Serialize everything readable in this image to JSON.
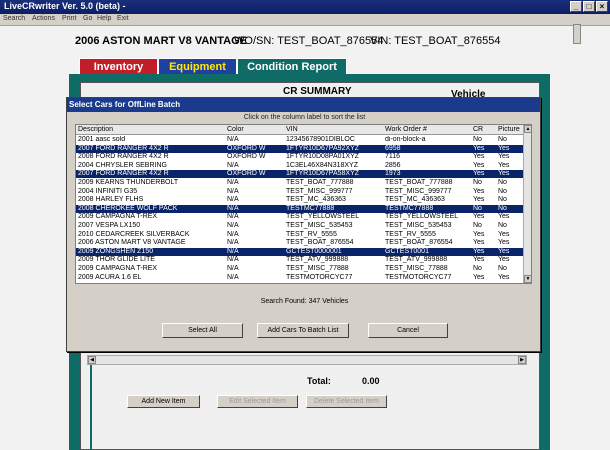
{
  "window": {
    "title": "LiveCRwriter Ver. 5.0 (beta) -",
    "buttons": [
      "_",
      "□",
      "×"
    ]
  },
  "menu": [
    "Search",
    "Actions",
    "Print",
    "Go",
    "Help",
    "Exit"
  ],
  "vehicle": {
    "year_model": "2006  ASTON MART V8 VANTAGE",
    "wo_sn": "WO/SN:  TEST_BOAT_876554",
    "vin": "VIN:  TEST_BOAT_876554"
  },
  "tabs": {
    "inventory": "Inventory",
    "equipment": "Equipment",
    "condition": "Condition Report"
  },
  "cr_summary": "CR SUMMARY",
  "vehicle_col": "Vehicle",
  "dialog": {
    "title": "Select Cars for OffLine Batch",
    "hint": "Click on the column label to sort the list",
    "columns": {
      "description": "Description",
      "color": "Color",
      "vin": "VIN",
      "work_order": "Work Order #",
      "cr": "CR",
      "picture": "Picture"
    },
    "rows": [
      {
        "desc": "2001  aasc sold",
        "color": "N/A",
        "vin": "12345678901DIBLOC",
        "wo": "di-on-block-a",
        "cr": "No",
        "pic": "No",
        "sel": false
      },
      {
        "desc": "2007  FORD RANGER 4X2 R",
        "color": "OXFORD W",
        "vin": "1FTYR10D67PA92XYZ",
        "wo": "6958",
        "cr": "Yes",
        "pic": "Yes",
        "sel": true
      },
      {
        "desc": "2008  FORD RANGER 4X2 R",
        "color": "OXFORD W",
        "vin": "1FTYR10D08PA01XYZ",
        "wo": "7116",
        "cr": "Yes",
        "pic": "Yes",
        "sel": false
      },
      {
        "desc": "2004  CHRYSLER SEBRING",
        "color": "N/A",
        "vin": "1C3EL46X84N318XYZ",
        "wo": "2856",
        "cr": "Yes",
        "pic": "Yes",
        "sel": false
      },
      {
        "desc": "2007  FORD RANGER 4X2 R",
        "color": "OXFORD W",
        "vin": "1FTYR10D67PA58XYZ",
        "wo": "1973",
        "cr": "Yes",
        "pic": "Yes",
        "sel": true
      },
      {
        "desc": "2009  KEARNS THUNDERBOLT",
        "color": "N/A",
        "vin": "TEST_BOAT_777888",
        "wo": "TEST_BOAT_777888",
        "cr": "No",
        "pic": "No",
        "sel": false
      },
      {
        "desc": "2004  INFINITI G35",
        "color": "N/A",
        "vin": "TEST_MISC_999777",
        "wo": "TEST_MISC_999777",
        "cr": "Yes",
        "pic": "No",
        "sel": false
      },
      {
        "desc": "2008  HARLEY FLHS",
        "color": "N/A",
        "vin": "TEST_MC_436363",
        "wo": "TEST_MC_436363",
        "cr": "Yes",
        "pic": "No",
        "sel": false
      },
      {
        "desc": "2008  CHEROKEE WOLF PACK",
        "color": "N/A",
        "vin": "TESTMC77888",
        "wo": "TESTMC77888",
        "cr": "No",
        "pic": "No",
        "sel": true
      },
      {
        "desc": "2009  CAMPAGNA T-REX",
        "color": "N/A",
        "vin": "TEST_YELLOWSTEEL",
        "wo": "TEST_YELLOWSTEEL",
        "cr": "Yes",
        "pic": "Yes",
        "sel": false
      },
      {
        "desc": "2007  VESPA LX150",
        "color": "N/A",
        "vin": "TEST_MISC_535453",
        "wo": "TEST_MISC_535453",
        "cr": "No",
        "pic": "No",
        "sel": false
      },
      {
        "desc": "2010  CEDARCREEK SILVERBACK",
        "color": "N/A",
        "vin": "TEST_RV_5555",
        "wo": "TEST_RV_5555",
        "cr": "Yes",
        "pic": "Yes",
        "sel": false
      },
      {
        "desc": "2006  ASTON MART V8 VANTAGE",
        "color": "N/A",
        "vin": "TEST_BOAT_876554",
        "wo": "TEST_BOAT_876554",
        "cr": "Yes",
        "pic": "Yes",
        "sel": false
      },
      {
        "desc": "2009  ZONGSHEN Z150",
        "color": "N/A",
        "vin": "GCTEST0000001",
        "wo": "GCTEST0001",
        "cr": "Yes",
        "pic": "Yes",
        "sel": true
      },
      {
        "desc": "2009  THOR GLIDE LITE",
        "color": "N/A",
        "vin": "TEST_ATV_999888",
        "wo": "TEST_ATV_999888",
        "cr": "Yes",
        "pic": "Yes",
        "sel": false
      },
      {
        "desc": "2009  CAMPAGNA T-REX",
        "color": "N/A",
        "vin": "TEST_MISC_77888",
        "wo": "TEST_MISC_77888",
        "cr": "No",
        "pic": "No",
        "sel": false
      },
      {
        "desc": "2009  ACURA 1.6 EL",
        "color": "N/A",
        "vin": "TESTMOTORCYC77",
        "wo": "TESTMOTORCYC77",
        "cr": "Yes",
        "pic": "Yes",
        "sel": false
      }
    ],
    "search_found": "Search Found: 347 Vehicles",
    "buttons": {
      "select_all": "Select All",
      "add_cars": "Add Cars To Batch List",
      "cancel": "Cancel"
    }
  },
  "lower": {
    "total_label": "Total:",
    "total_value": "0.00",
    "add_new_item": "Add New Item",
    "edit_selected_item": "Edit Selected Item",
    "delete_selected_item": "Delete Selected Item"
  }
}
